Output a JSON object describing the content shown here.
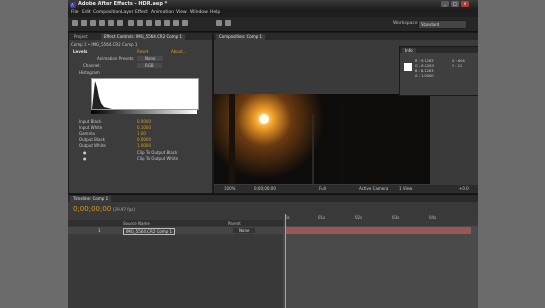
{
  "app": {
    "title": "Adobe After Effects - HDR.aep *"
  },
  "window_controls": {
    "minimize": "_",
    "maximize": "□",
    "close": "×"
  },
  "menu": [
    "File",
    "Edit",
    "Composition",
    "Layer",
    "Effect",
    "Animation",
    "View",
    "Window",
    "Help"
  ],
  "workspace": {
    "label": "Workspace:",
    "value": "Standard"
  },
  "left_panel": {
    "tabs": [
      "Project",
      "Effect Controls: IMG_5564.CR2 Comp 1"
    ],
    "breadcrumb": "Comp 1 • IMG_5564.CR2 Comp 1",
    "effect": {
      "name": "Levels",
      "reset": "Reset",
      "about": "About..."
    },
    "animation_presets": {
      "label": "Animation Presets:",
      "value": "None"
    },
    "channel": {
      "label": "Channel:",
      "value": "RGB"
    },
    "histogram_label": "Histogram",
    "params": [
      {
        "label": "Input Black",
        "value": "0.0000"
      },
      {
        "label": "Input White",
        "value": "0.1000"
      },
      {
        "label": "Gamma",
        "value": "1.00"
      },
      {
        "label": "Output Black",
        "value": "0.0000"
      },
      {
        "label": "Output White",
        "value": "1.0000"
      }
    ],
    "clip_black": "Clip To Output Black",
    "clip_white": "Clip To Output White"
  },
  "comp_panel": {
    "tab": "Composition: Comp 1",
    "info": {
      "title": "Info",
      "r": "R : 9.1263",
      "g": "G : 8.1263",
      "b": "B : 8.1263",
      "a": "A : 1.0000",
      "x": "X : 604",
      "y": "Y : 21"
    },
    "viewer_bar": {
      "zoom": "100%",
      "timecode": "0;00;00;00",
      "res": "Full",
      "camera": "Active Camera",
      "views": "1 View",
      "offset": "+0.0"
    }
  },
  "timeline": {
    "tab": "Timeline: Comp 1",
    "timecode": "0;00;00;00",
    "fps": "(29.97 fps)",
    "columns": {
      "source": "Source Name",
      "parent": "Parent"
    },
    "layer": {
      "index": "1",
      "name": "IMG_5564.CR2 Comp 1",
      "parent": "None"
    },
    "ruler": [
      "0s",
      "01s",
      "02s",
      "03s",
      "04s"
    ]
  }
}
